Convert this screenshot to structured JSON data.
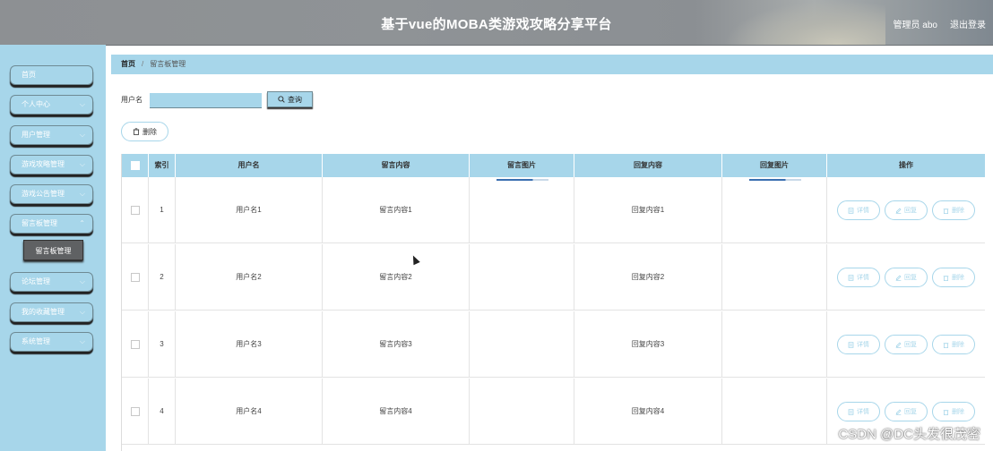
{
  "header": {
    "title": "基于vue的MOBA类游戏攻略分享平台",
    "user": "管理员 abo",
    "logout": "退出登录"
  },
  "sidebar": {
    "items": [
      {
        "label": "首页",
        "has_arrow": false
      },
      {
        "label": "个人中心",
        "has_arrow": true
      },
      {
        "label": "用户管理",
        "has_arrow": true
      },
      {
        "label": "游戏攻略管理",
        "has_arrow": true
      },
      {
        "label": "游戏公告管理",
        "has_arrow": true
      },
      {
        "label": "留言板管理",
        "has_arrow": true,
        "expanded": true
      },
      {
        "label": "论坛管理",
        "has_arrow": true
      },
      {
        "label": "我的收藏管理",
        "has_arrow": true
      },
      {
        "label": "系统管理",
        "has_arrow": true
      }
    ],
    "sub_item": "留言板管理"
  },
  "breadcrumb": {
    "home": "首页",
    "current": "留言板管理"
  },
  "search": {
    "label": "用户名",
    "value": "",
    "button": "查询"
  },
  "delete_button": "删除",
  "table": {
    "headers": [
      "索引",
      "用户名",
      "留言内容",
      "留言图片",
      "回复内容",
      "回复图片",
      "操作"
    ],
    "rows": [
      {
        "index": "1",
        "username": "用户名1",
        "content": "留言内容1",
        "reply": "回复内容1"
      },
      {
        "index": "2",
        "username": "用户名2",
        "content": "留言内容2",
        "reply": "回复内容2"
      },
      {
        "index": "3",
        "username": "用户名3",
        "content": "留言内容3",
        "reply": "回复内容3"
      },
      {
        "index": "4",
        "username": "用户名4",
        "content": "留言内容4",
        "reply": "回复内容4"
      }
    ],
    "actions": [
      "详情",
      "回复",
      "删除"
    ]
  },
  "watermark": "CSDN @DC头发很茂密",
  "colors": {
    "accent": "#a7d6ea",
    "submenu": "#5f6163"
  }
}
